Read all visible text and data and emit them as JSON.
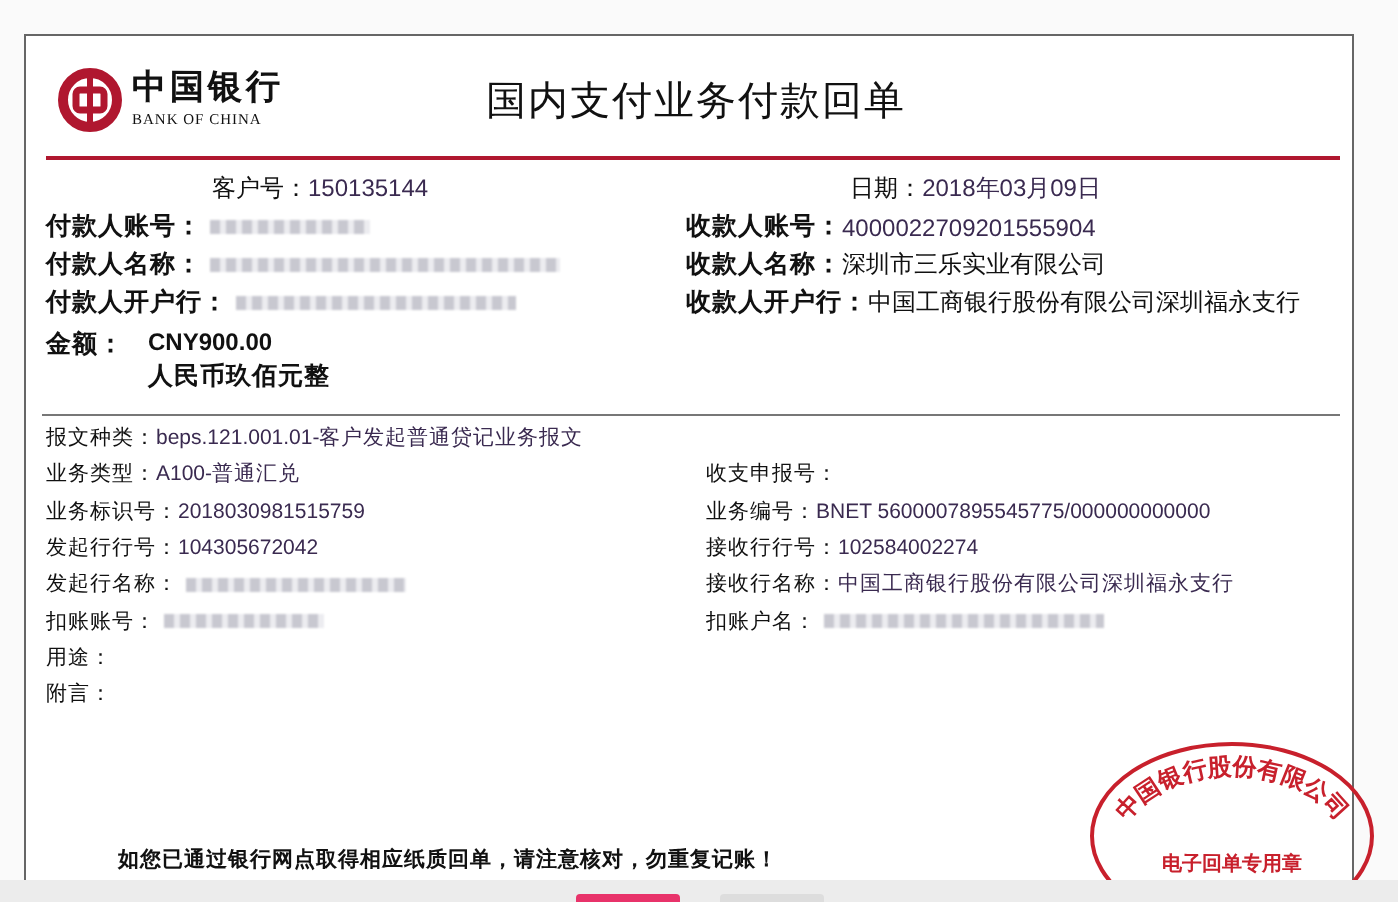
{
  "header": {
    "bank_name_zh": "中国银行",
    "bank_name_en": "BANK OF CHINA",
    "title": "国内支付业务付款回单"
  },
  "customer": {
    "label": "客户号：",
    "value": "150135144"
  },
  "date": {
    "label": "日期：",
    "value": "2018年03月09日"
  },
  "payer": [
    {
      "label": "付款人账号：",
      "kind": "redacted"
    },
    {
      "label": "付款人名称：",
      "kind": "redacted"
    },
    {
      "label": "付款人开户行：",
      "kind": "redacted"
    }
  ],
  "payee": [
    {
      "label": "收款人账号：",
      "kind": "text",
      "value": "4000022709201555904"
    },
    {
      "label": "收款人名称：",
      "kind": "text",
      "value": "深圳市三乐实业有限公司"
    },
    {
      "label": "收款人开户行：",
      "kind": "text",
      "value": "中国工商银行股份有限公司深圳福永支行"
    }
  ],
  "amount": {
    "label": "金额：",
    "figure": "CNY900.00",
    "words": "人民币玖佰元整"
  },
  "details_left": [
    {
      "label": "报文种类：",
      "kind": "text",
      "value": "beps.121.001.01-客户发起普通贷记业务报文"
    },
    {
      "label": "业务类型：",
      "kind": "text",
      "value": "A100-普通汇兑"
    },
    {
      "label": "业务标识号：",
      "kind": "text",
      "value": "2018030981515759"
    },
    {
      "label": "发起行行号：",
      "kind": "text",
      "value": "104305672042"
    },
    {
      "label": "发起行名称：",
      "kind": "redacted"
    },
    {
      "label": "扣账账号：",
      "kind": "redacted"
    },
    {
      "label": "用途：",
      "kind": "empty"
    },
    {
      "label": "附言：",
      "kind": "empty"
    }
  ],
  "details_right": [
    {
      "label": "收支申报号：",
      "kind": "empty"
    },
    {
      "label": "业务编号：",
      "kind": "text",
      "value": "BNET 5600007895545775/000000000000"
    },
    {
      "label": "接收行行号：",
      "kind": "text",
      "value": "102584002274"
    },
    {
      "label": "接收行名称：",
      "kind": "text",
      "value": "中国工商银行股份有限公司深圳福永支行"
    },
    {
      "label": "扣账户名：",
      "kind": "redacted"
    }
  ],
  "notice": "如您已通过银行网点取得相应纸质回单，请注意核对，勿重复记账！",
  "stamp": {
    "top_text": "中国银行股份有限公司",
    "bottom_text": "电子回单专用章"
  }
}
